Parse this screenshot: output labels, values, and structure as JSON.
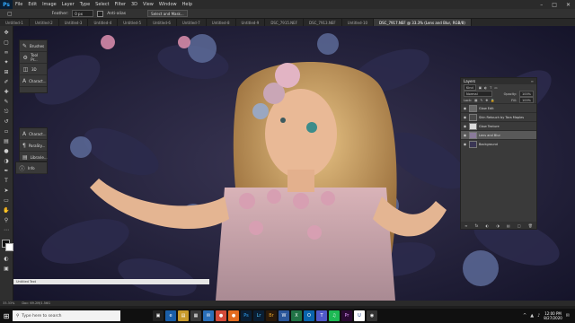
{
  "menu": {
    "items": [
      "File",
      "Edit",
      "Image",
      "Layer",
      "Type",
      "Select",
      "Filter",
      "3D",
      "View",
      "Window",
      "Help"
    ],
    "app_icon": "Ps"
  },
  "options_bar": {
    "feather_label": "Feather:",
    "feather_value": "0 px",
    "antialias_label": "Anti-alias",
    "style_button": "Select and Mask..."
  },
  "tabs": [
    {
      "label": "Untitled-1",
      "active": false
    },
    {
      "label": "Untitled-2",
      "active": false
    },
    {
      "label": "Untitled-3",
      "active": false
    },
    {
      "label": "Untitled-4",
      "active": false
    },
    {
      "label": "Untitled-5",
      "active": false
    },
    {
      "label": "Untitled-6",
      "active": false
    },
    {
      "label": "Untitled-7",
      "active": false
    },
    {
      "label": "Untitled-8",
      "active": false
    },
    {
      "label": "Untitled-9",
      "active": false
    },
    {
      "label": "DSC_7915.NEF",
      "active": false
    },
    {
      "label": "DSC_7913.NEF",
      "active": false
    },
    {
      "label": "Untitled-10",
      "active": false
    },
    {
      "label": "DSC_7917.NEF @ 33.3% (Lens and Blur, RGB/8)",
      "active": true
    }
  ],
  "floating_panel": {
    "rows": [
      {
        "icon": "brush-icon",
        "label": "Brushes"
      },
      {
        "icon": "tool-presets-icon",
        "label": "Tool Pr..."
      },
      {
        "icon": "history-icon",
        "label": "3D"
      },
      {
        "icon": "character-icon",
        "label": "Charact..."
      }
    ],
    "rows2": [
      {
        "icon": "character-styles-icon",
        "label": "Charact..."
      },
      {
        "icon": "paragraph-icon",
        "label": "ParaSty..."
      },
      {
        "icon": "libraries-icon",
        "label": "Librarie..."
      }
    ],
    "rows3": [
      {
        "icon": "info-icon",
        "label": "Info"
      }
    ]
  },
  "layers": {
    "title": "Layers",
    "kind_label": "Kind",
    "blend_mode": "Normal",
    "opacity_label": "Opacity:",
    "opacity_value": "100%",
    "lock_label": "Lock:",
    "fill_label": "Fill:",
    "fill_value": "100%",
    "items": [
      {
        "name": "Glow Edit",
        "selected": false
      },
      {
        "name": "Skin Retouch by Tara Maples",
        "selected": false
      },
      {
        "name": "Glow Texture",
        "selected": false
      },
      {
        "name": "Lens and Blur",
        "selected": true
      },
      {
        "name": "Background",
        "selected": false
      }
    ]
  },
  "status": {
    "zoom": "33.33%",
    "doc": "Doc: 69.2M/1.56G"
  },
  "text_strip": "Untitled Text",
  "taskbar": {
    "search_placeholder": "Type here to search",
    "time": "12:00 PM",
    "date": "8/27/2020"
  }
}
